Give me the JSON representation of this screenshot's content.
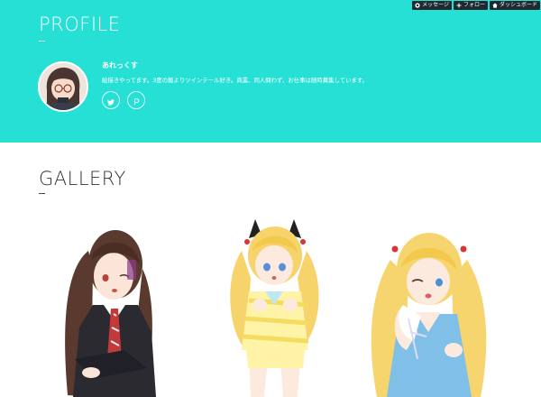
{
  "topbar": {
    "items": [
      {
        "label": "メッセージ",
        "icon": "message-icon"
      },
      {
        "label": "フォロー",
        "icon": "plus-icon"
      },
      {
        "label": "ダッシュボード",
        "icon": "home-icon"
      }
    ]
  },
  "profile": {
    "title": "PROFILE",
    "name": "あれっくす",
    "bio": "絵描きやってます。3度の飯よりツインテール好き。商業、同人問わず、お仕事は随時募集しています。",
    "social": [
      {
        "icon": "twitter-icon"
      },
      {
        "icon": "pixiv-icon"
      }
    ]
  },
  "gallery": {
    "title": "GALLERY",
    "items": [
      {
        "icon": "artwork-image"
      },
      {
        "icon": "artwork-image"
      },
      {
        "icon": "artwork-image"
      }
    ]
  },
  "colors": {
    "accent": "#27e0d5",
    "topbar": "#1f2a30",
    "text": "#333333"
  }
}
